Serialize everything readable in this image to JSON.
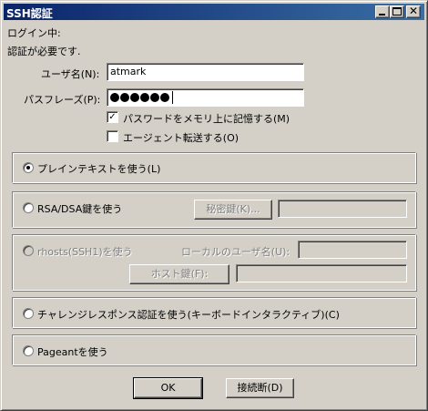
{
  "window": {
    "title": "SSH認証"
  },
  "header": {
    "status": "ログイン中:",
    "message": "認証が必要です."
  },
  "form": {
    "username_label": "ユーザ名(N):",
    "username_value": "atmark",
    "passphrase_label": "パスフレーズ(P):",
    "passphrase_dot_count": 6,
    "remember_label": "パスワードをメモリ上に記憶する(M)",
    "remember_checked": true,
    "agent_label": "エージェント転送する(O)",
    "agent_checked": false
  },
  "methods": {
    "plaintext_label": "プレインテキストを使う(L)",
    "rsa_label": "RSA/DSA鍵を使う",
    "secret_key_button": "秘密鍵(K)...",
    "rhosts_label": "rhosts(SSH1)を使う",
    "local_user_label": "ローカルのユーザ名(U):",
    "host_key_button": "ホスト鍵(F):",
    "challenge_label": "チャレンジレスポンス認証を使う(キーボードインタラクティブ)(C)",
    "pageant_label": "Pageantを使う",
    "selected": "plaintext"
  },
  "buttons": {
    "ok": "OK",
    "disconnect": "接続断(D)"
  }
}
